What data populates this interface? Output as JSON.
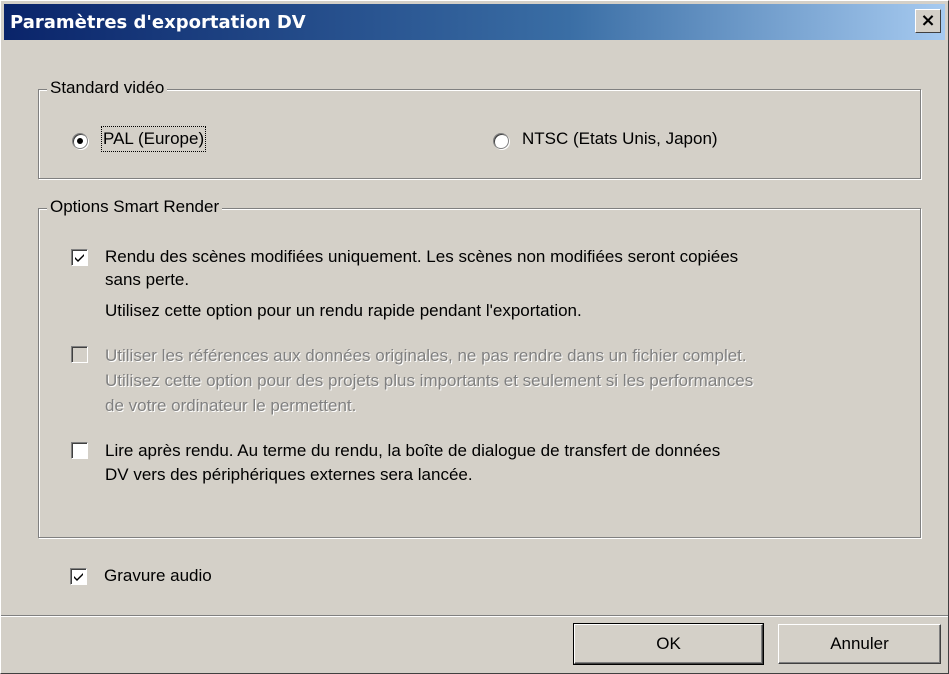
{
  "window": {
    "title": "Paramètres d'exportation DV",
    "close_glyph": "×"
  },
  "video_standard": {
    "legend": "Standard vidéo",
    "options": [
      {
        "label": "PAL (Europe)",
        "selected": true
      },
      {
        "label": "NTSC (Etats Unis, Japon)",
        "selected": false
      }
    ]
  },
  "smart_render": {
    "legend": "Options Smart Render",
    "options": [
      {
        "checked": true,
        "enabled": true,
        "lines": [
          "Rendu des scènes modifiées uniquement. Les scènes non modifiées seront copiées",
          "sans perte.",
          "Utilisez cette option pour un rendu rapide pendant l'exportation."
        ]
      },
      {
        "checked": false,
        "enabled": false,
        "lines": [
          "Utiliser les références aux données originales, ne pas rendre dans un fichier complet.",
          "Utilisez cette option pour des projets plus importants et seulement si les performances",
          "de votre ordinateur le permettent."
        ]
      },
      {
        "checked": false,
        "enabled": true,
        "lines": [
          "Lire après rendu. Au terme du rendu, la boîte de dialogue de transfert de données",
          "DV vers des périphériques externes sera lancée."
        ]
      }
    ]
  },
  "audio_burn": {
    "label": "Gravure audio",
    "checked": true
  },
  "buttons": {
    "ok": "OK",
    "cancel": "Annuler"
  }
}
